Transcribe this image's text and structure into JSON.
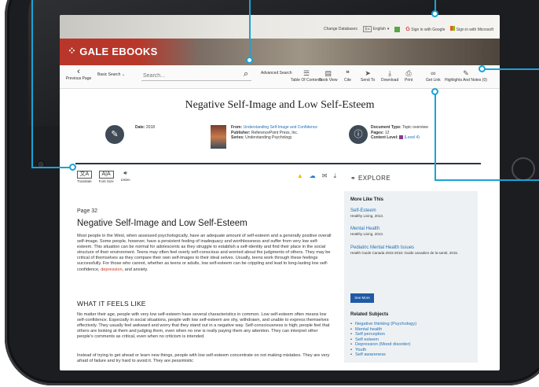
{
  "topbar": {
    "change_databases": "Change Databases",
    "language": "English",
    "sign_in_google": "Sign in with Google",
    "sign_in_microsoft": "Sign in with Microsoft"
  },
  "brand": {
    "name": "GALE EBOOKS"
  },
  "toolbar": {
    "previous_page": "Previous Page",
    "basic_search": "Basic Search ⌄",
    "search_placeholder": "Search...",
    "advanced_search": "Advanced Search",
    "tools": [
      {
        "label": "Table Of Contents"
      },
      {
        "label": "Book View"
      },
      {
        "label": "Cite"
      },
      {
        "label": "Send To"
      },
      {
        "label": "Download"
      },
      {
        "label": "Print"
      },
      {
        "label": "Get Link"
      },
      {
        "label": "Highlights And Notes (0)"
      }
    ]
  },
  "document": {
    "title": "Negative Self-Image and Low Self-Esteem",
    "date_label": "Date:",
    "date": "2018",
    "from_label": "From:",
    "from": "Understanding Self-Image and Confidence",
    "publisher_label": "Publisher:",
    "publisher": "ReferencePoint Press, Inc.",
    "series_label": "Series:",
    "series": "Understanding Psychology",
    "doc_type_label": "Document Type:",
    "doc_type": "Topic overview",
    "pages_label": "Pages:",
    "pages": "12",
    "content_level_label": "Content Level:",
    "content_level": "(Level 4)"
  },
  "article": {
    "tools": [
      {
        "label": "Translate"
      },
      {
        "label": "Font Size"
      },
      {
        "label": "Listen"
      }
    ],
    "page": "Page 32",
    "heading": "Negative Self-Image and Low Self-Esteem",
    "p1": "Most people in the West, when assessed psychologically, have an adequate amount of self-esteem and a generally positive overall self-image. Some people, however, have a persistent feeling of inadequacy and worthlessness and suffer from very low self-esteem. This situation can be normal for adolescents as they struggle to establish a self-identity and find their place in the social structure of their environment. Teens may often feel overly self-conscious and worried about the judgments of others. They may be critical of themselves as they compare their own self-images to their ideal selves. Usually, teens work through these feelings successfully. For those who cannot, whether as teens or adults, low self-esteem can be crippling and lead to long-lasting low self-confidence,",
    "p1_link": "depression",
    "p1_end": ", and anxiety.",
    "subheading": "WHAT IT FEELS LIKE",
    "p2": "No matter their age, people with very low self-esteem have several characteristics in common. Low self-esteem often means low self-confidence. Especially in social situations, people with low self-esteem are shy, withdrawn, and unable to express themselves effectively. They usually feel awkward and worry that they stand out in a negative way. Self-consciousness is high; people feel that others are looking at them and judging them, even when no one is really paying them any attention. They can interpret other people's comments as critical, even when no criticism is intended.",
    "p3": "Instead of trying to get ahead or learn new things, people with low self-esteem concentrate on not making mistakes. They are very afraid of failure and try hard to avoid it. They are pessimistic"
  },
  "explore": {
    "header": "EXPLORE",
    "more_like_this": "More Like This",
    "items": [
      {
        "title": "Self-Esteem",
        "source": "Healthy Living, 2013."
      },
      {
        "title": "Mental Health",
        "source": "Healthy Living, 2013."
      },
      {
        "title": "Pediatric Mental Health Issues",
        "source": "Health Guide Canada 2015-2016: Guide canadien de la santé, 2015."
      }
    ],
    "see_more": "See More",
    "related_subjects": "Related Subjects",
    "subjects": [
      "Negative thinking (Psychology)",
      "Mental health",
      "Self perception",
      "Self esteem",
      "Depression (Mood disorder)",
      "Youth",
      "Self awareness"
    ]
  },
  "colors": {
    "accent_blue": "#1f6fb5",
    "brand_red": "#b8372a",
    "callout": "#1aa3d9",
    "button_blue": "#1f5aa6"
  }
}
